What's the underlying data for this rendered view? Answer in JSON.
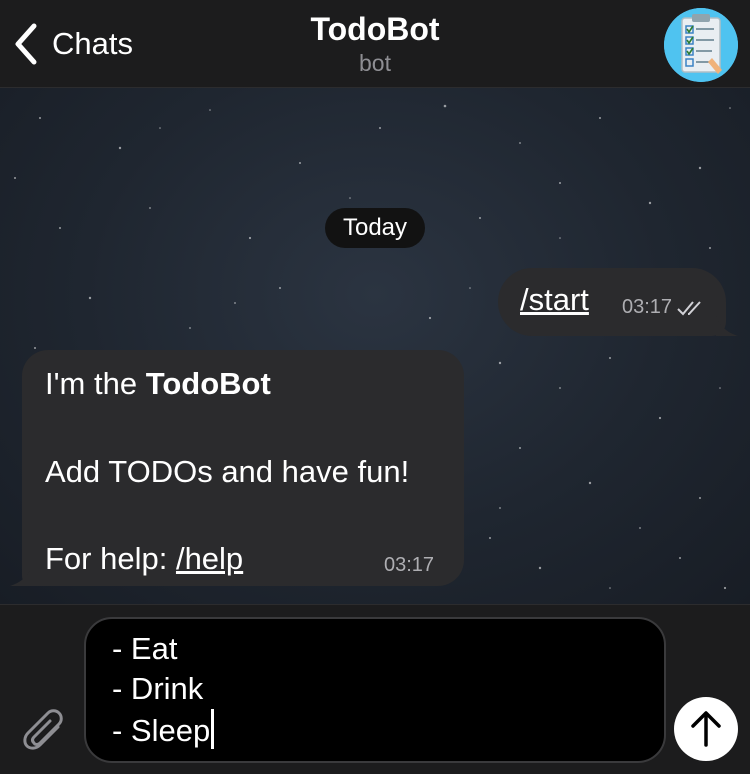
{
  "header": {
    "back_label": "Chats",
    "title": "TodoBot",
    "subtitle": "bot",
    "avatar_icon": "clipboard-checklist-icon"
  },
  "chat": {
    "date_label": "Today",
    "outgoing": {
      "text": "/start",
      "time": "03:17",
      "status_icon": "double-check-icon"
    },
    "incoming": {
      "line1_prefix": "I'm the ",
      "line1_bold": "TodoBot",
      "line2": "Add TODOs and have fun!",
      "line3_prefix": "For help: ",
      "line3_link": "/help",
      "time": "03:17"
    }
  },
  "composer": {
    "text_lines": [
      "- Eat",
      "- Drink",
      "- Sleep"
    ],
    "attach_icon": "paperclip-icon",
    "send_icon": "arrow-up-icon"
  },
  "colors": {
    "bubble": "#2b2b2d",
    "background": "#1c1c1e",
    "secondary_text": "#8e8e93"
  }
}
